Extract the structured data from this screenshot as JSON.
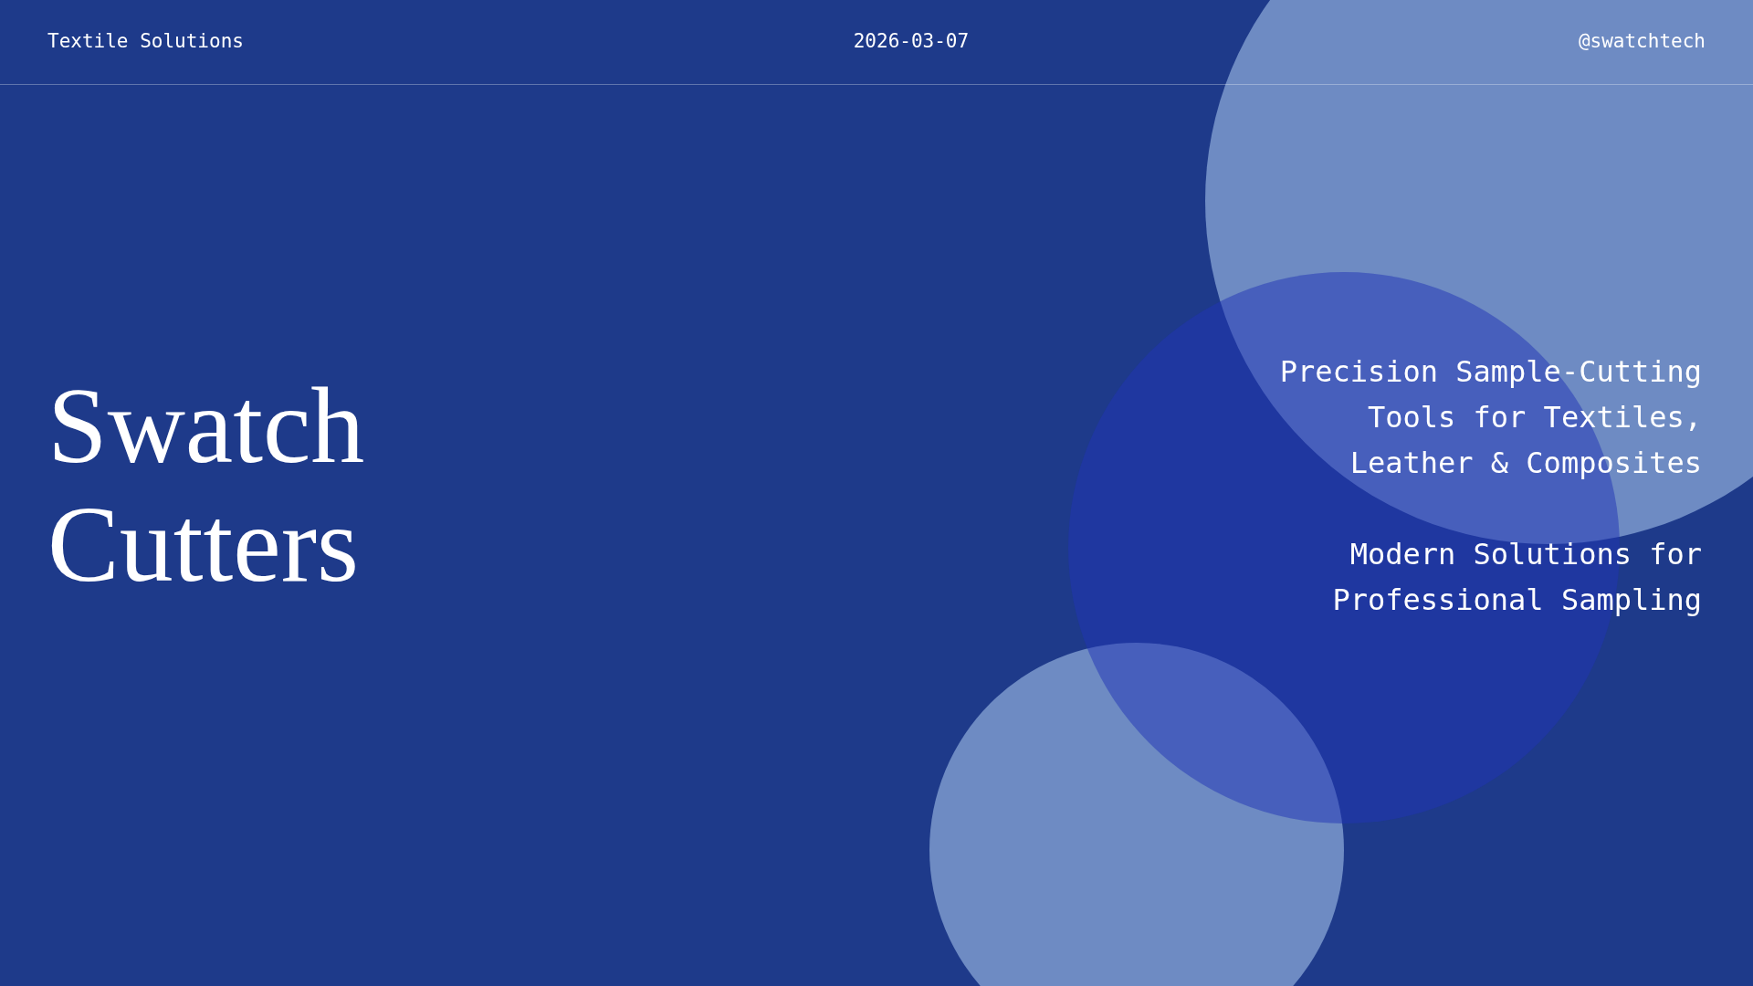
{
  "header": {
    "brand": "Textile Solutions",
    "date": "2026-03-07",
    "handle": "@swatchtech"
  },
  "title_lines": [
    "Swatch",
    "Cutters"
  ],
  "taglines": [
    [
      "Precision Sample-Cutting",
      "Tools for Textiles,",
      "Leather & Composites"
    ],
    [
      "Modern Solutions for",
      "Professional Sampling"
    ]
  ]
}
